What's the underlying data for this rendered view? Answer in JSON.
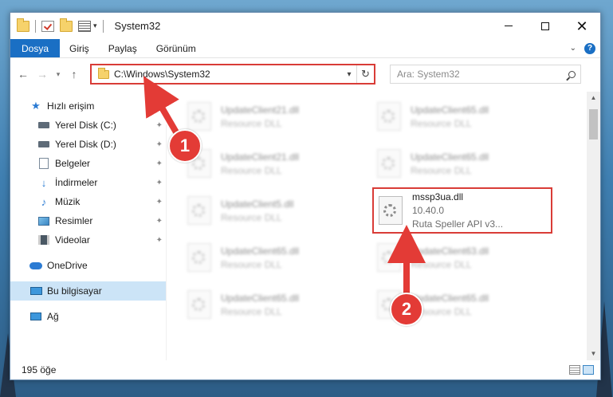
{
  "window": {
    "title": "System32",
    "quick_access_dropdown": "▾"
  },
  "ribbon": {
    "tabs": [
      "Dosya",
      "Giriş",
      "Paylaş",
      "Görünüm"
    ],
    "expand_icon": "chevron-down-icon",
    "help_icon": "help-icon",
    "help_label": "?"
  },
  "controls": {
    "minimize": "minimize-icon",
    "maximize": "maximize-icon",
    "close_label": "✕"
  },
  "nav": {
    "back": "←",
    "forward": "→",
    "recent": "▾",
    "up": "↑"
  },
  "address": {
    "path": "C:\\Windows\\System32",
    "dropdown": "▾",
    "refresh": "↻"
  },
  "search": {
    "placeholder": "Ara: System32"
  },
  "sidebar": {
    "items": [
      {
        "label": "Hızlı erişim",
        "icon": "star-icon",
        "pinned": false
      },
      {
        "label": "Yerel Disk (C:)",
        "icon": "disk-icon",
        "pinned": true
      },
      {
        "label": "Yerel Disk (D:)",
        "icon": "disk-icon",
        "pinned": true
      },
      {
        "label": "Belgeler",
        "icon": "documents-icon",
        "pinned": true
      },
      {
        "label": "İndirmeler",
        "icon": "download-icon",
        "pinned": true
      },
      {
        "label": "Müzik",
        "icon": "music-icon",
        "pinned": true
      },
      {
        "label": "Resimler",
        "icon": "pictures-icon",
        "pinned": true
      },
      {
        "label": "Videolar",
        "icon": "videos-icon",
        "pinned": true
      },
      {
        "label": "OneDrive",
        "icon": "cloud-icon",
        "pinned": false
      },
      {
        "label": "Bu bilgisayar",
        "icon": "computer-icon",
        "pinned": false,
        "selected": true
      },
      {
        "label": "Ağ",
        "icon": "network-icon",
        "pinned": false
      }
    ],
    "pin_glyph": "📌"
  },
  "files": {
    "left_column": [
      {
        "name": "UpdateClient21.dll",
        "desc": "Resource DLL"
      },
      {
        "name": "UpdateClient21.dll",
        "desc": "Resource DLL"
      },
      {
        "name": "UpdateClient5.dll",
        "desc": "Resource DLL"
      },
      {
        "name": "UpdateClient65.dll",
        "desc": "Resource DLL"
      },
      {
        "name": "UpdateClient65.dll",
        "desc": "Resource DLL"
      }
    ],
    "right_column": [
      {
        "name": "UpdateClient65.dll",
        "desc": "Resource DLL"
      },
      {
        "name": "UpdateClient65.dll",
        "desc": "Resource DLL"
      },
      {
        "name": "mssp3ua.dll",
        "version": "10.40.0",
        "desc": "Ruta Speller API v3...",
        "highlighted": true
      },
      {
        "name": "UpdateClient63.dll",
        "desc": "Resource DLL"
      },
      {
        "name": "UpdateClient65.dll",
        "desc": "Resource DLL"
      }
    ]
  },
  "status": {
    "count": "195 öğe"
  },
  "annotations": {
    "step1": "1",
    "step2": "2",
    "highlight_color": "#d93c37"
  }
}
